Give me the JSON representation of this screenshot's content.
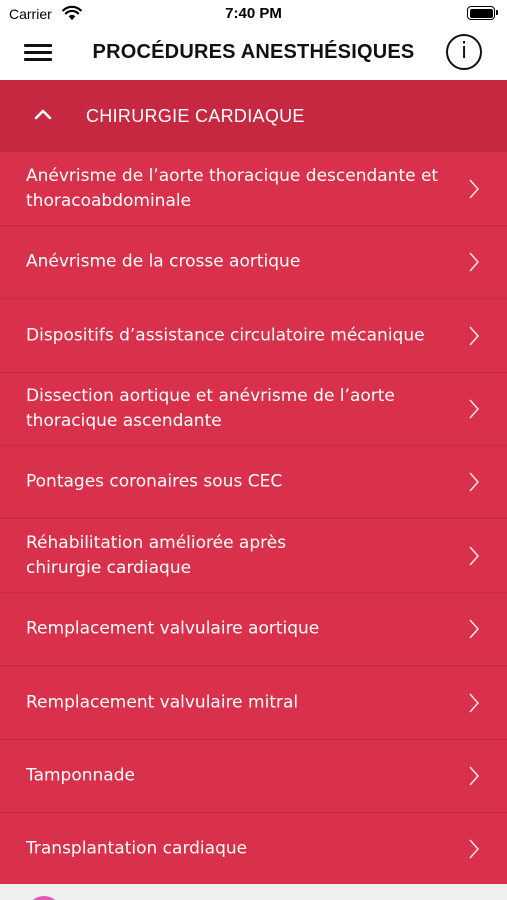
{
  "status_bar": {
    "carrier": "Carrier",
    "time": "7:40 PM"
  },
  "nav": {
    "title": "PROCÉDURES ANESTHÉSIQUES",
    "info_label": "i"
  },
  "section": {
    "title": "CHIRURGIE CARDIAQUE",
    "expanded": true
  },
  "colors": {
    "header_red": "#c52840",
    "list_red": "#d9314b",
    "divider": "#c32a41"
  },
  "items": [
    {
      "label": "Anévrisme de l’aorte thoracique descendante et thoracoabdominale"
    },
    {
      "label": "Anévrisme de la crosse aortique"
    },
    {
      "label": "Dispositifs d’assistance circulatoire mécanique"
    },
    {
      "label": "Dissection aortique et anévrisme de l’aorte thoracique ascendante"
    },
    {
      "label": "Pontages coronaires sous CEC"
    },
    {
      "label": "Réhabilitation améliorée après chirurgie cardiaque"
    },
    {
      "label": "Remplacement valvulaire aortique"
    },
    {
      "label": "Remplacement valvulaire mitral"
    },
    {
      "label": "Tamponnade"
    },
    {
      "label": "Transplantation cardiaque"
    }
  ]
}
